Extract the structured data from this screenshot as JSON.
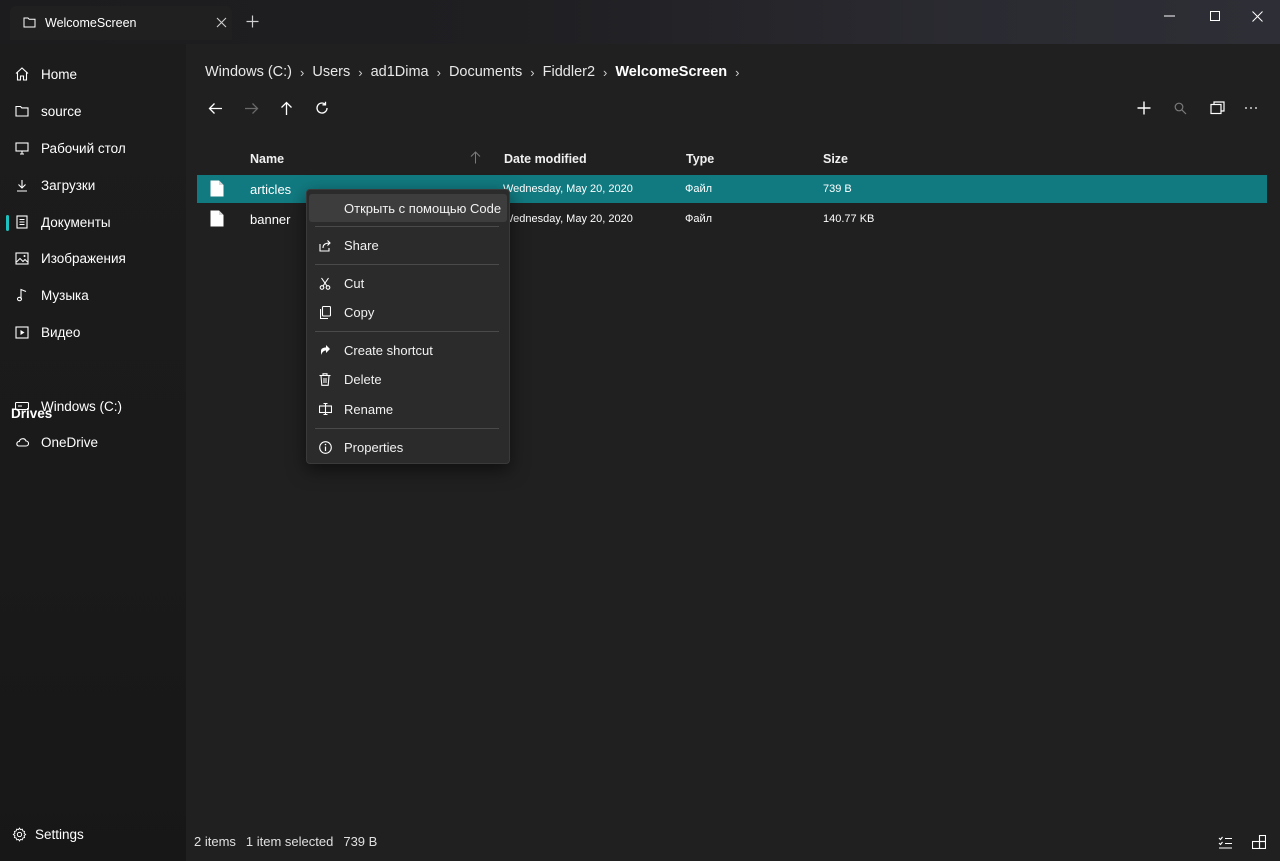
{
  "window": {
    "tab_title": "WelcomeScreen"
  },
  "sidebar": {
    "items": [
      {
        "label": "Home",
        "icon": "home-icon"
      },
      {
        "label": "source",
        "icon": "folder-icon"
      },
      {
        "label": "Рабочий стол",
        "icon": "desktop-icon"
      },
      {
        "label": "Загрузки",
        "icon": "download-icon"
      },
      {
        "label": "Документы",
        "icon": "document-icon"
      },
      {
        "label": "Изображения",
        "icon": "image-icon"
      },
      {
        "label": "Музыка",
        "icon": "music-icon"
      },
      {
        "label": "Видео",
        "icon": "video-icon"
      }
    ],
    "drives_header": "Drives",
    "drives": [
      {
        "label": "Windows (C:)",
        "icon": "drive-icon"
      },
      {
        "label": "OneDrive",
        "icon": "cloud-icon"
      }
    ],
    "settings_label": "Settings"
  },
  "breadcrumb": [
    "Windows (C:)",
    "Users",
    "ad1Dima",
    "Documents",
    "Fiddler2",
    "WelcomeScreen"
  ],
  "columns": {
    "name": "Name",
    "date": "Date modified",
    "type": "Type",
    "size": "Size"
  },
  "files": [
    {
      "name": "articles",
      "date": "Wednesday, May 20, 2020",
      "type": "Файл",
      "size": "739 B",
      "selected": true
    },
    {
      "name": "banner",
      "date": "Wednesday, May 20, 2020",
      "type": "Файл",
      "size": "140.77 KB",
      "selected": false
    }
  ],
  "context_menu": {
    "open_with": "Открыть с помощью Code",
    "share": "Share",
    "cut": "Cut",
    "copy": "Copy",
    "create_shortcut": "Create shortcut",
    "delete": "Delete",
    "rename": "Rename",
    "properties": "Properties"
  },
  "status_bar": {
    "item_count": "2 items",
    "selection": "1 item selected",
    "selection_size": "739 B"
  },
  "colors": {
    "accent": "#117a80",
    "active_indicator": "#1ec0c0",
    "background": "#202020"
  }
}
